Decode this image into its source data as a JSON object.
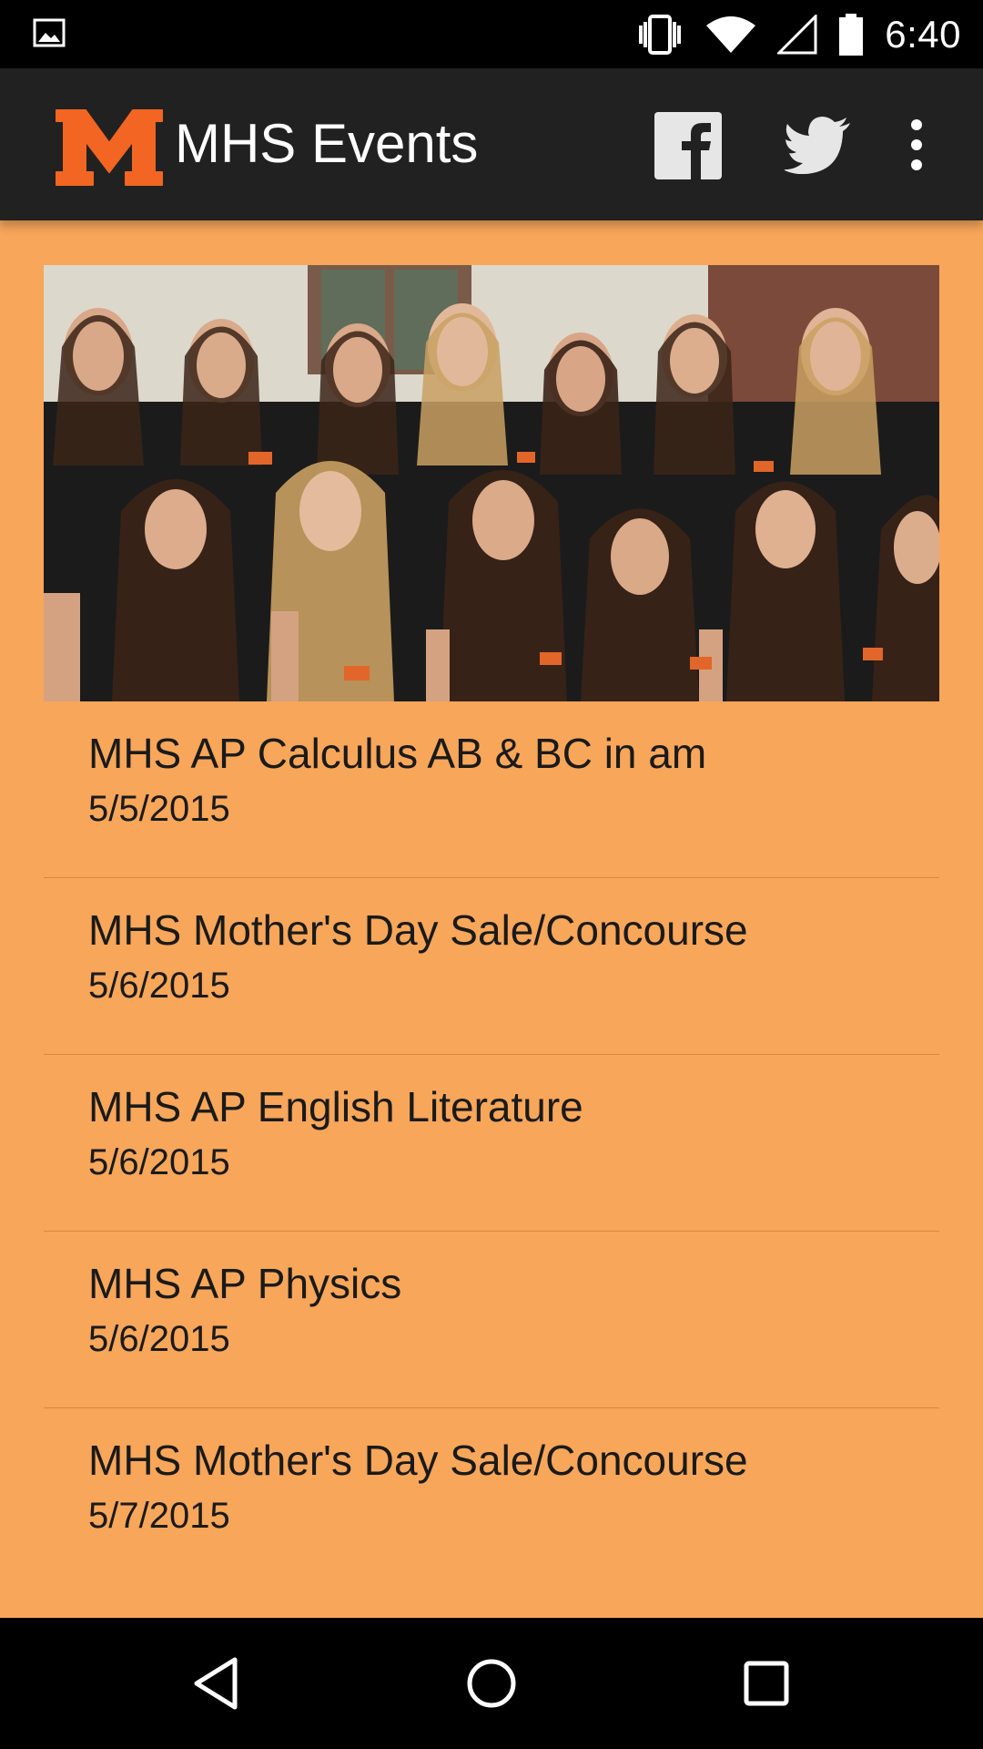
{
  "status_bar": {
    "time": "6:40",
    "icons": [
      "image-notification-icon",
      "vibrate-icon",
      "wifi-icon",
      "cell-signal-icon",
      "battery-icon"
    ]
  },
  "app_bar": {
    "logo_icon": "mhs-m-logo-icon",
    "title": "MHS Events",
    "actions": [
      "facebook-icon",
      "twitter-icon",
      "overflow-menu-icon"
    ]
  },
  "hero": {
    "icon": "team-photo-image"
  },
  "events": [
    {
      "title": "MHS AP Calculus AB & BC in am",
      "date": "5/5/2015"
    },
    {
      "title": "MHS Mother's Day Sale/Concourse",
      "date": "5/6/2015"
    },
    {
      "title": "MHS AP English Literature",
      "date": "5/6/2015"
    },
    {
      "title": "MHS AP Physics",
      "date": "5/6/2015"
    },
    {
      "title": "MHS Mother's Day Sale/Concourse",
      "date": "5/7/2015"
    }
  ],
  "nav_bar": {
    "icons": [
      "back-icon",
      "home-icon",
      "recents-icon"
    ]
  },
  "colors": {
    "background": "#f7a65a",
    "app_bar": "#212121",
    "logo_orange": "#f26522",
    "text": "#1a1a1a"
  }
}
